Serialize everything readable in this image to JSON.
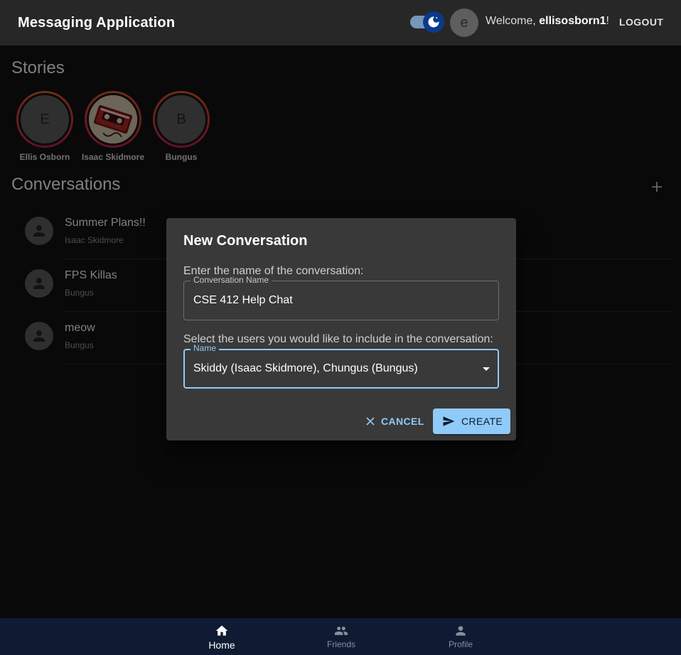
{
  "app": {
    "title": "Messaging Application",
    "welcome_prefix": "Welcome, ",
    "username": "ellisosborn1",
    "welcome_suffix": "!",
    "avatar_letter": "e",
    "logout_label": "LOGOUT",
    "theme_toggle": "dark-mode-on"
  },
  "stories": {
    "title": "Stories",
    "items": [
      {
        "letter": "E",
        "name": "Ellis Osborn"
      },
      {
        "letter": "",
        "name": "Isaac Skidmore",
        "image": "cassette-tape-photo"
      },
      {
        "letter": "B",
        "name": "Bungus"
      }
    ]
  },
  "conversations": {
    "title": "Conversations",
    "items": [
      {
        "title": "Summer Plans!!",
        "subtitle": "Isaac Skidmore"
      },
      {
        "title": "FPS Killas",
        "subtitle": "Bungus"
      },
      {
        "title": "meow",
        "subtitle": "Bungus"
      }
    ]
  },
  "dialog": {
    "title": "New Conversation",
    "name_prompt": "Enter the name of the conversation:",
    "name_field_label": "Conversation Name",
    "name_field_value": "CSE 412 Help Chat",
    "users_prompt": "Select the users you would like to include in the conversation:",
    "users_field_label": "Name",
    "users_field_value": "Skiddy (Isaac Skidmore), Chungus (Bungus)",
    "cancel_label": "CANCEL",
    "create_label": "CREATE"
  },
  "bottom_nav": {
    "items": [
      {
        "label": "Home",
        "icon": "home-icon",
        "active": true
      },
      {
        "label": "Friends",
        "icon": "people-icon",
        "active": false
      },
      {
        "label": "Profile",
        "icon": "person-icon",
        "active": false
      }
    ]
  },
  "colors": {
    "background": "#121212",
    "appbar": "#272727",
    "accent": "#90caf9",
    "dialog": "#393939",
    "bottom_nav": "#0f1b33",
    "story_ring": "#e85d1c"
  }
}
